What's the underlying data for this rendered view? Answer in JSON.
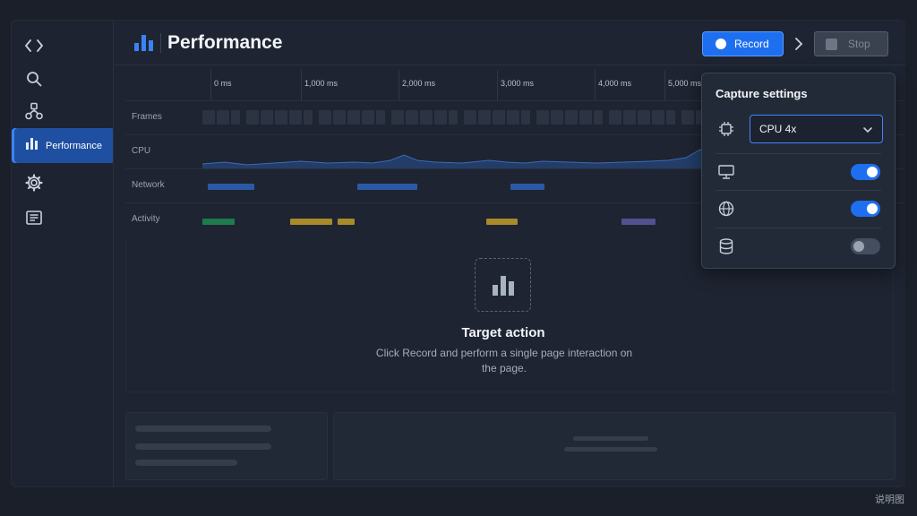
{
  "sidebar": {
    "items": [
      {
        "icon": "code-icon"
      },
      {
        "icon": "search-icon"
      },
      {
        "icon": "network-nodes-icon"
      },
      {
        "icon": "performance-icon",
        "label": "Performance",
        "active": true
      },
      {
        "icon": "gear-icon"
      },
      {
        "icon": "document-icon"
      }
    ]
  },
  "header": {
    "title": "Performance",
    "record_label": "Record",
    "stop_label": "Stop"
  },
  "timeline": {
    "ticks": [
      "0 ms",
      "1,000 ms",
      "2,000 ms",
      "3,000 ms",
      "4,000 ms",
      "5,000 ms"
    ],
    "tracks": [
      "Frames",
      "CPU",
      "Network",
      "Activity"
    ]
  },
  "empty_state": {
    "title": "Target action",
    "description": "Click Record and perform a single page interaction on the page."
  },
  "capture_settings": {
    "title": "Capture settings",
    "cpu_throttle": "CPU 4x",
    "options": [
      {
        "icon": "monitor-icon",
        "enabled": true
      },
      {
        "icon": "globe-icon",
        "enabled": true
      },
      {
        "icon": "database-icon",
        "enabled": false
      }
    ]
  },
  "footer": {
    "corner_label": "说明图"
  },
  "colors": {
    "accent": "#1e6ff0",
    "network_bar": "#2a5aa6",
    "activity_green": "#1f7a4e",
    "activity_yellow": "#a88a2a",
    "activity_purple": "#54508f"
  }
}
